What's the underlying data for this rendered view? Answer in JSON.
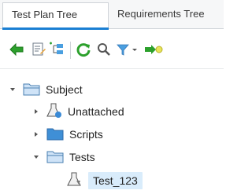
{
  "tabs": [
    {
      "label": "Test Plan Tree",
      "active": true
    },
    {
      "label": "Requirements Tree",
      "active": false
    }
  ],
  "toolbar": {
    "icons": [
      "back-arrow-icon",
      "edit-details-icon",
      "new-folder-icon",
      "refresh-icon",
      "search-icon",
      "filter-icon",
      "go-to-icon"
    ]
  },
  "tree": {
    "root": {
      "label": "Subject"
    },
    "children": [
      {
        "label": "Unattached"
      },
      {
        "label": "Scripts"
      },
      {
        "label": "Tests"
      }
    ],
    "grandchild": {
      "label": "Test_123"
    }
  },
  "colors": {
    "accent": "#1a7fd3",
    "selection": "#d9ecfb",
    "green": "#2ca02c"
  }
}
